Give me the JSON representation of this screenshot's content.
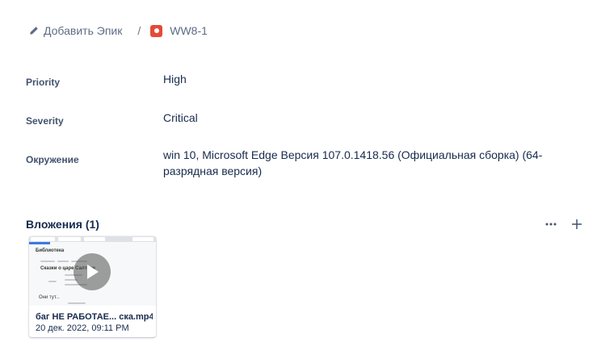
{
  "breadcrumb": {
    "epic_label": "Добавить Эпик",
    "separator": "/",
    "issue_key": "WW8-1"
  },
  "fields": [
    {
      "label": "Priority",
      "value": "High"
    },
    {
      "label": "Severity",
      "value": "Critical"
    },
    {
      "label": "Окружение",
      "value": "win 10, Microsoft Edge Версия 107.0.1418.56 (Официальная сборка) (64-разрядная версия)"
    }
  ],
  "attachments": {
    "title": "Вложения (1)",
    "more_icon": "more-horizontal-icon",
    "add_icon": "plus-icon",
    "items": [
      {
        "name": "баг НЕ РАБОТАЕ... ска.mp4",
        "date": "20 дек. 2022, 09:11 PM",
        "thumb_heading": "Библиотека",
        "thumb_subheading": "Сказки о царе Салтане",
        "thumb_footer": "Они тут..."
      }
    ]
  },
  "colors": {
    "bug": "#e5493a",
    "text": "#172b4d",
    "subtle": "#5e6c84"
  }
}
